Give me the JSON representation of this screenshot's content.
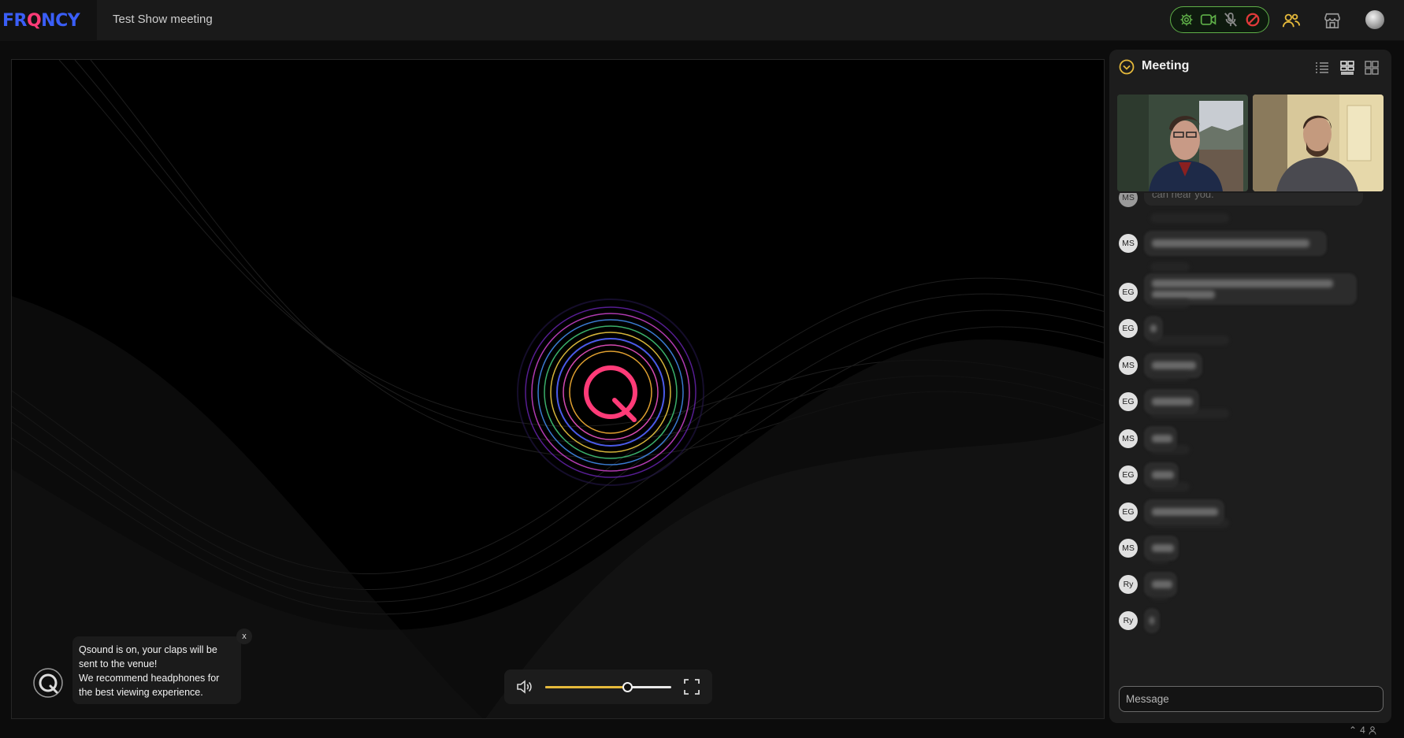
{
  "app": {
    "logo_part1": "FR",
    "logo_q": "Q",
    "logo_part2": "NCY",
    "meeting_title": "Test Show meeting"
  },
  "colors": {
    "brand_blue": "#3a5ef7",
    "brand_pink": "#ff3b78",
    "pill_green": "#5fb048",
    "blocked_red": "#e03a3a",
    "slider_gold": "#e5b93b",
    "collapse_gold": "#e5b93b"
  },
  "topbar": {
    "controls": [
      {
        "icon": "gear-icon"
      },
      {
        "icon": "video-camera-icon"
      },
      {
        "icon": "microphone-muted-icon"
      },
      {
        "icon": "blocked-icon"
      }
    ],
    "people_icon": "people-icon",
    "store_icon": "storefront-icon"
  },
  "notice": {
    "line1": "Qsound is on, your claps will be",
    "line2": "sent to the venue!",
    "line3": "We recommend headphones for",
    "line4": "the best viewing experience.",
    "close": "x"
  },
  "player": {
    "volume": 0.65
  },
  "panel": {
    "title": "Meeting",
    "views": [
      "list-view-icon",
      "grid-view-icon",
      "tile-view-icon"
    ],
    "top_message": {
      "initials": "MS",
      "text": "can hear you."
    },
    "messages": [
      {
        "initials": "MS"
      },
      {
        "initials": "EG"
      },
      {
        "initials": "EG"
      },
      {
        "initials": "MS"
      },
      {
        "initials": "EG"
      },
      {
        "initials": "MS"
      },
      {
        "initials": "EG"
      },
      {
        "initials": "EG"
      },
      {
        "initials": "MS"
      },
      {
        "initials": "Ry"
      },
      {
        "initials": "Ry"
      }
    ],
    "message_placeholder": "Message"
  },
  "footer": {
    "count": "4"
  }
}
